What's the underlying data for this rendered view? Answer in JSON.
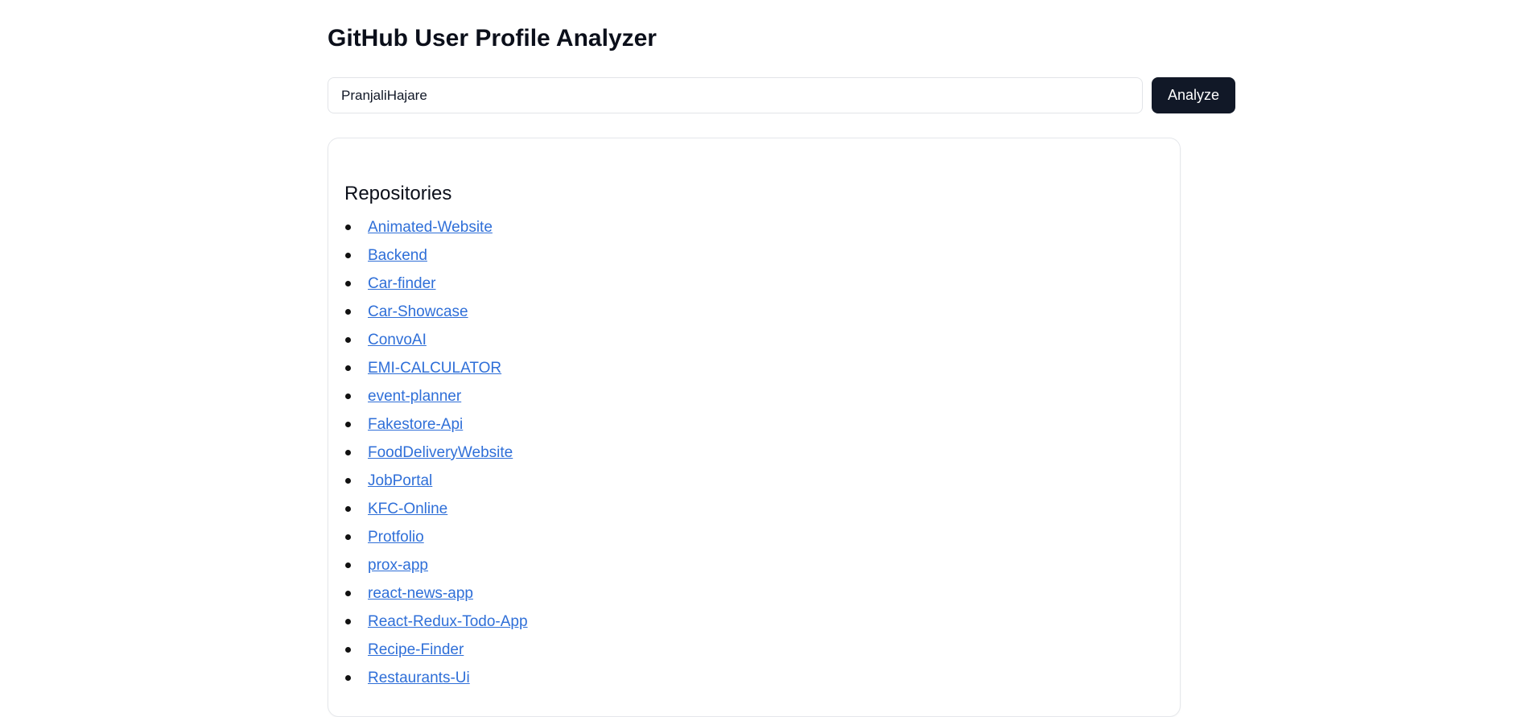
{
  "header": {
    "title": "GitHub User Profile Analyzer"
  },
  "search": {
    "value": "PranjaliHajare",
    "button_label": "Analyze"
  },
  "repositories": {
    "heading": "Repositories",
    "items": [
      "Animated-Website",
      "Backend",
      "Car-finder",
      "Car-Showcase",
      "ConvoAI",
      "EMI-CALCULATOR",
      "event-planner",
      "Fakestore-Api",
      "FoodDeliveryWebsite",
      "JobPortal",
      "KFC-Online",
      "Protfolio",
      "prox-app",
      "react-news-app",
      "React-Redux-Todo-App",
      "Recipe-Finder",
      "Restaurants-Ui"
    ]
  },
  "colors": {
    "link": "#2f6fd8",
    "button_bg": "#111827",
    "border": "#e5e7eb"
  }
}
